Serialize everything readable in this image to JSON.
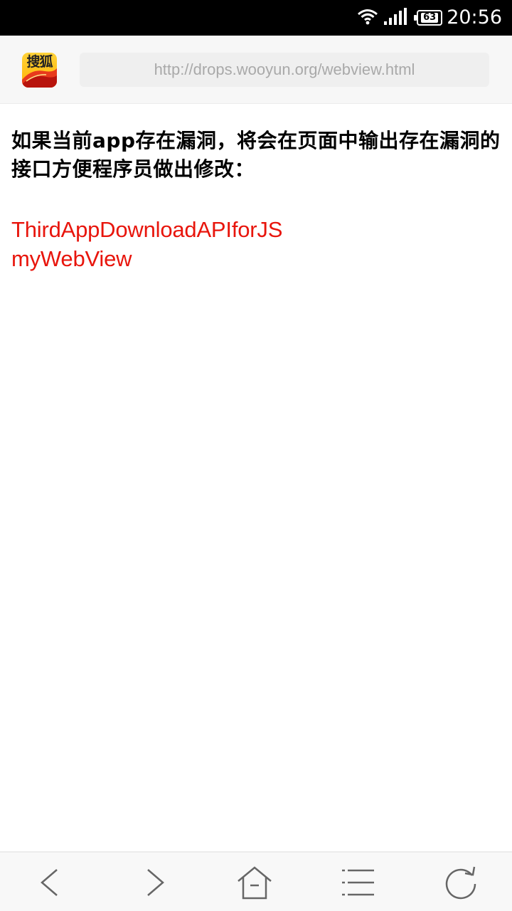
{
  "status_bar": {
    "battery": "63",
    "time": "20:56"
  },
  "browser": {
    "app_logo_text": "搜狐",
    "url": "http://drops.wooyun.org/webview.html"
  },
  "page": {
    "message": "如果当前app存在漏洞，将会在页面中输出存在漏洞的接口方便程序员做出修改：",
    "interfaces": [
      "ThirdAppDownloadAPIforJS",
      "myWebView"
    ]
  },
  "toolbar": {
    "icons": [
      "back-icon",
      "forward-icon",
      "home-icon",
      "menu-icon",
      "refresh-icon"
    ]
  },
  "colors": {
    "status_bar": "#000000",
    "browser_bar": "#f7f7f7",
    "url_field": "#efefef",
    "interface_text": "#e8150c",
    "icon_stroke": "#666666"
  }
}
